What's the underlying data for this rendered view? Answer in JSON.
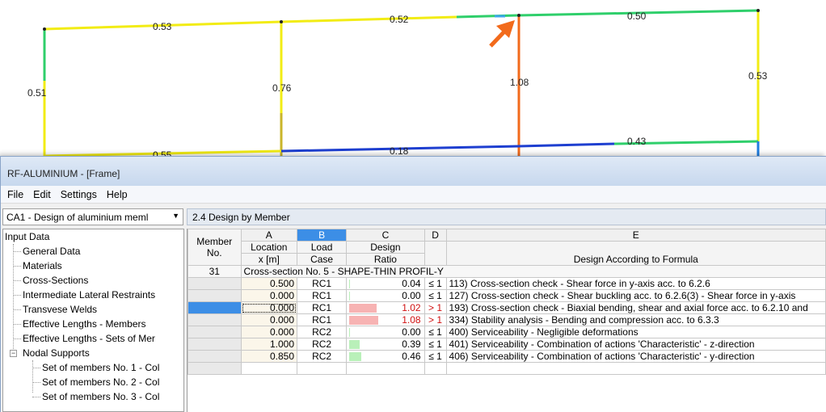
{
  "model": {
    "labels": [
      "0.53",
      "0.52",
      "0.50",
      "0.51",
      "0.76",
      "1.08",
      "0.53",
      "0.55",
      "0.18",
      "0.43"
    ]
  },
  "window": {
    "title": "RF-ALUMINIUM - [Frame]",
    "menu": [
      "File",
      "Edit",
      "Settings",
      "Help"
    ]
  },
  "navigator": {
    "case_select": "CA1 - Design of aluminium meml",
    "tree": {
      "root": "Input Data",
      "items": [
        "General Data",
        "Materials",
        "Cross-Sections",
        "Intermediate Lateral Restraints",
        "Transvese Welds",
        "Effective Lengths - Members",
        "Effective Lengths - Sets of Mer"
      ],
      "nodal_supports": "Nodal Supports",
      "subitems": [
        "Set of members No. 1 - Col",
        "Set of members No. 2 - Col",
        "Set of members No. 3 - Col"
      ]
    }
  },
  "panel": {
    "title": "2.4 Design by Member"
  },
  "table": {
    "letters": [
      "A",
      "B",
      "C",
      "D",
      "E"
    ],
    "member_header": [
      "Member",
      "No."
    ],
    "headers": {
      "a": [
        "Location",
        "x [m]"
      ],
      "b": [
        "Load",
        "Case"
      ],
      "c": [
        "Design",
        "Ratio"
      ],
      "d": "",
      "e": "Design According to Formula"
    },
    "member_no": "31",
    "section_text": "Cross-section No.  5 - SHAPE-THIN PROFIL-Y",
    "rows": [
      {
        "x": "0.500",
        "lc": "RC1",
        "ratio": 0.04,
        "ratio_text": "0.04",
        "cmp": "≤ 1",
        "formula": "113) Cross-section check - Shear force in y-axis acc. to 6.2.6"
      },
      {
        "x": "0.000",
        "lc": "RC1",
        "ratio": 0.0,
        "ratio_text": "0.00",
        "cmp": "≤ 1",
        "formula": "127) Cross-section check - Shear buckling acc. to 6.2.6(3) - Shear force in y-axis"
      },
      {
        "x": "0.000",
        "lc": "RC1",
        "ratio": 1.02,
        "ratio_text": "1.02",
        "cmp": "> 1",
        "formula": "193) Cross-section check - Biaxial bending, shear and axial force acc. to 6.2.10 and"
      },
      {
        "x": "0.000",
        "lc": "RC1",
        "ratio": 1.08,
        "ratio_text": "1.08",
        "cmp": "> 1",
        "formula": "334) Stability analysis - Bending and compression acc. to 6.3.3"
      },
      {
        "x": "0.000",
        "lc": "RC2",
        "ratio": 0.0,
        "ratio_text": "0.00",
        "cmp": "≤ 1",
        "formula": "400) Serviceability - Negligible deformations"
      },
      {
        "x": "1.000",
        "lc": "RC2",
        "ratio": 0.39,
        "ratio_text": "0.39",
        "cmp": "≤ 1",
        "formula": "401) Serviceability - Combination of actions 'Characteristic' - z-direction"
      },
      {
        "x": "0.850",
        "lc": "RC2",
        "ratio": 0.46,
        "ratio_text": "0.46",
        "cmp": "≤ 1",
        "formula": "406) Serviceability - Combination of actions 'Characteristic' - y-direction"
      }
    ]
  },
  "colors": {
    "member_yellow": "#f2ec14",
    "member_green": "#2fcf6b",
    "member_orange": "#f26a1b",
    "member_blue": "#1e3fd0",
    "arrow": "#f26a1b",
    "ratio_ok": "#b9f0b9",
    "ratio_fail": "#f7b3b3",
    "selected": "#3c8ee6"
  }
}
